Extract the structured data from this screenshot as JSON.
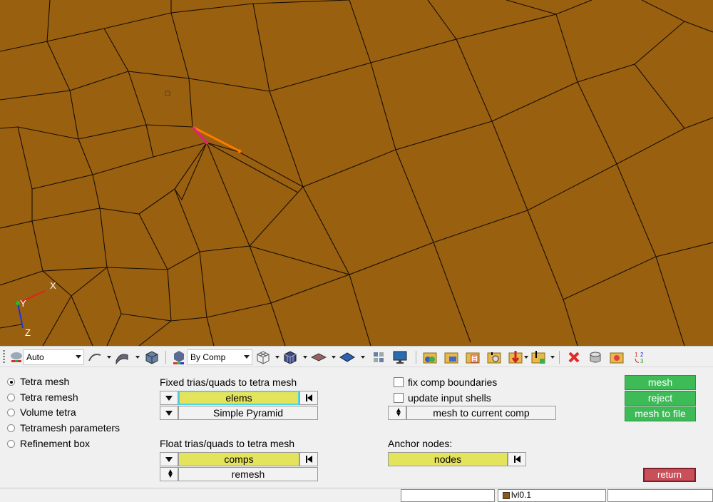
{
  "viewport": {
    "mesh_color": "#996010",
    "edge_color": "#1a0e02",
    "highlight_colors": [
      "#ff7a00",
      "#e0207a"
    ],
    "triad": {
      "x": "X",
      "y": "Y",
      "z": "Z"
    }
  },
  "toolbar": {
    "view_select": "Auto",
    "color_select": "By Comp",
    "icons": [
      "grip-icon",
      "visualization-icon",
      "geometry-shading-icon",
      "surface-shading-icon",
      "solid-cube-icon",
      "by-comp-color-icon",
      "wireframe-cube-icon",
      "shaded-cube-icon",
      "shrink-elements-icon",
      "flat-shade-icon",
      "element-grid-icon",
      "monitor-icon",
      "components-icon",
      "component-folder-icon",
      "component-table-icon",
      "find-icon",
      "mask-icon",
      "unmask-icon",
      "delete-icon",
      "cylinder-icon",
      "review-folder-icon",
      "numbering-icon"
    ]
  },
  "panel": {
    "modes": [
      {
        "label": "Tetra mesh",
        "selected": true
      },
      {
        "label": "Tetra remesh",
        "selected": false
      },
      {
        "label": "Volume tetra",
        "selected": false
      },
      {
        "label": "Tetramesh parameters",
        "selected": false
      },
      {
        "label": "Refinement box",
        "selected": false
      }
    ],
    "fixed_title": "Fixed trias/quads to tetra mesh",
    "fixed_entity": "elems",
    "fixed_type": "Simple Pyramid",
    "float_title": "Float trias/quads to tetra mesh",
    "float_entity": "comps",
    "float_type": "remesh",
    "fix_comp_boundaries": "fix comp boundaries",
    "update_input_shells": "update input shells",
    "component_dest": "mesh to current comp",
    "anchor_title": "Anchor nodes:",
    "anchor_entity": "nodes",
    "buttons": {
      "mesh": "mesh",
      "reject": "reject",
      "mesh_to_file": "mesh to file",
      "return": "return"
    }
  },
  "statusbar": {
    "component": "lvl0.1",
    "component_color": "#8c5a16"
  }
}
